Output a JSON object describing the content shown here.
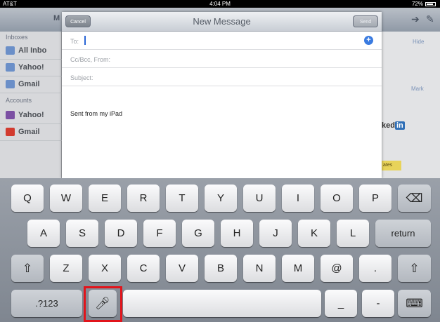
{
  "status_bar": {
    "carrier": "AT&T",
    "time": "4:04 PM",
    "battery": "72%"
  },
  "background_app": {
    "nav_title_fragment": "M",
    "sidebar": {
      "inboxes_header": "Inboxes",
      "accounts_header": "Accounts",
      "inbox_items": [
        {
          "label": "All Inbo",
          "icon": "mailbox-icon",
          "color": "#6b8fc8"
        },
        {
          "label": "Yahoo!",
          "icon": "mailbox-icon",
          "color": "#6b8fc8"
        },
        {
          "label": "Gmail",
          "icon": "mailbox-icon",
          "color": "#6b8fc8"
        }
      ],
      "account_items": [
        {
          "label": "Yahoo!",
          "icon": "yahoo-icon",
          "color": "#7b4fa3"
        },
        {
          "label": "Gmail",
          "icon": "gmail-icon",
          "color": "#d23b2f"
        }
      ]
    },
    "right_panel": {
      "hide_label": "Hide",
      "more_label": "Mark",
      "linkedin_text": "ked",
      "linkedin_box": "in",
      "dates_label": "ates"
    },
    "nav_icons": [
      "reply-icon",
      "compose-icon"
    ]
  },
  "compose": {
    "title": "New Message",
    "cancel_label": "Cancel",
    "send_label": "Send",
    "to_label": "To:",
    "cc_label": "Cc/Bcc, From:",
    "subject_label": "Subject:",
    "body": "Sent from my iPad",
    "add_contact_icon": "plus-circle-icon",
    "accent_color": "#3a7be0"
  },
  "keyboard": {
    "row1": [
      "Q",
      "W",
      "E",
      "R",
      "T",
      "Y",
      "U",
      "I",
      "O",
      "P"
    ],
    "row2": [
      "A",
      "S",
      "D",
      "F",
      "G",
      "H",
      "J",
      "K",
      "L"
    ],
    "row3": [
      "Z",
      "X",
      "C",
      "V",
      "B",
      "N",
      "M",
      "@",
      "."
    ],
    "return_label": "return",
    "numbers_label": ".?123",
    "underscore_label": "_",
    "dash_label": "-",
    "delete_icon": "backspace-icon",
    "shift_icon": "shift-icon",
    "mic_icon": "microphone-icon",
    "hide_keyboard_icon": "keyboard-hide-icon",
    "highlight_color": "#e1141b"
  }
}
